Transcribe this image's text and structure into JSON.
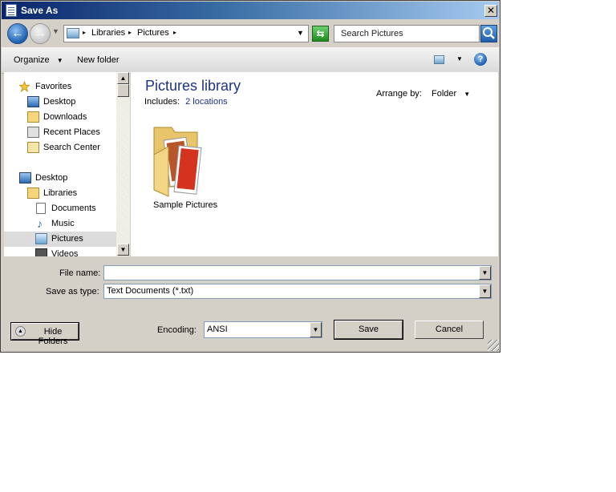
{
  "window": {
    "title": "Save As",
    "close_label": "✕"
  },
  "nav": {
    "back_icon": "←",
    "forward_icon": "→",
    "history_icon": "▼",
    "breadcrumb": [
      "Libraries",
      "Pictures"
    ],
    "separator": "▸",
    "address_dropdown": "▼",
    "refresh_icon": "⇆",
    "search_placeholder": "Search Pictures"
  },
  "toolbar": {
    "organize_label": "Organize",
    "new_folder_label": "New folder",
    "dropdown_glyph": "▼",
    "help_glyph": "?"
  },
  "sidebar": {
    "favorites_label": "Favorites",
    "favorites": [
      {
        "label": "Desktop",
        "icon": "desktop-icon"
      },
      {
        "label": "Downloads",
        "icon": "downloads-icon"
      },
      {
        "label": "Recent Places",
        "icon": "recent-places-icon"
      },
      {
        "label": "Search Center",
        "icon": "search-center-icon"
      }
    ],
    "desktop_label": "Desktop",
    "libraries_label": "Libraries",
    "libraries": [
      {
        "label": "Documents",
        "icon": "documents-icon"
      },
      {
        "label": "Music",
        "icon": "music-icon"
      },
      {
        "label": "Pictures",
        "icon": "pictures-icon",
        "selected": true
      },
      {
        "label": "Videos",
        "icon": "videos-icon"
      }
    ]
  },
  "main": {
    "title": "Pictures library",
    "includes_label": "Includes:",
    "includes_value": "2 locations",
    "arrange_label": "Arrange by:",
    "arrange_value": "Folder",
    "items": [
      {
        "label": "Sample Pictures",
        "icon": "folder-icon"
      }
    ]
  },
  "form": {
    "file_name_label": "File name:",
    "file_name_value": "",
    "save_type_label": "Save as type:",
    "save_type_value": "Text Documents (*.txt)",
    "encoding_label": "Encoding:",
    "encoding_value": "ANSI",
    "save_label": "Save",
    "cancel_label": "Cancel",
    "hide_folders_label": "Hide Folders",
    "hide_folders_icon": "▲"
  }
}
